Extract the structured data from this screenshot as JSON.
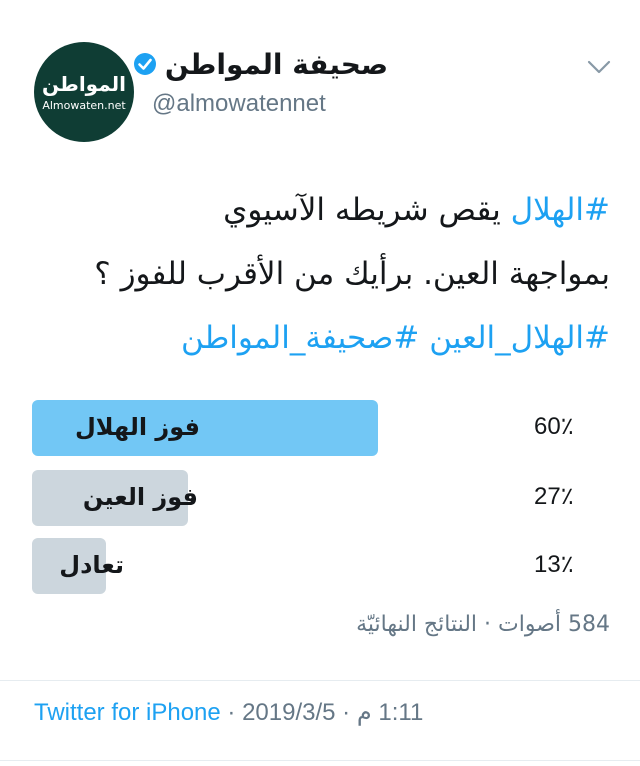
{
  "account": {
    "display_name": "صحيفة المواطن",
    "handle": "@almowatennet",
    "avatar_logo_text": "المواطن",
    "avatar_logo_url_text": "Almowaten.net",
    "verified": true
  },
  "tweet": {
    "hashtag_1": "#الهلال",
    "text_line_1": " يقص شريطه الآسيوي",
    "text_line_2": "بمواجهة العين. برأيك من الأقرب للفوز ؟",
    "hashtag_2": "#الهلال_العين",
    "hashtag_3": "#صحيفة_المواطن"
  },
  "poll": {
    "options": [
      {
        "label": "فوز الهلال",
        "percent_text": "60٪",
        "percent": 60,
        "winner": true
      },
      {
        "label": "فوز العين",
        "percent_text": "27٪",
        "percent": 27,
        "winner": false
      },
      {
        "label": "تعادل",
        "percent_text": "13٪",
        "percent": 13,
        "winner": false
      }
    ],
    "summary": "584 أصوات · النتائج النهائيّة"
  },
  "footer": {
    "source": "Twitter for iPhone",
    "separator": " · ",
    "date": "2019/3/5",
    "time": "1:11 م"
  },
  "colors": {
    "accent": "#1da1f2",
    "winner_bar": "#72c7f5",
    "other_bar": "#ccd6dd",
    "avatar_bg": "#0f3d34"
  },
  "icons": [
    "chevron-down-icon",
    "verified-badge-icon"
  ]
}
